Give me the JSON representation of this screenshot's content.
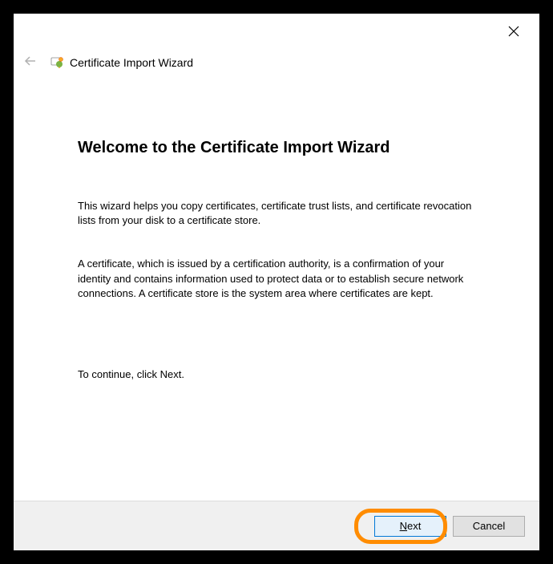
{
  "header": {
    "title": "Certificate Import Wizard"
  },
  "content": {
    "heading": "Welcome to the Certificate Import Wizard",
    "paragraph1": "This wizard helps you copy certificates, certificate trust lists, and certificate revocation lists from your disk to a certificate store.",
    "paragraph2": "A certificate, which is issued by a certification authority, is a confirmation of your identity and contains information used to protect data or to establish secure network connections. A certificate store is the system area where certificates are kept.",
    "continue_text": "To continue, click Next."
  },
  "footer": {
    "next_prefix": "N",
    "next_suffix": "ext",
    "cancel_label": "Cancel"
  }
}
